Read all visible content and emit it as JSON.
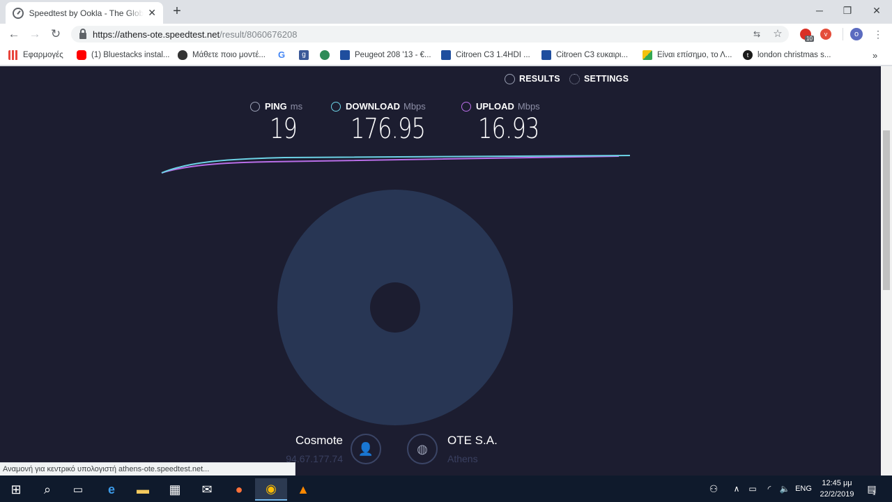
{
  "browser": {
    "tab_title": "Speedtest by Ookla - The Global Broadband Speed Test",
    "url_host": "https://athens-ote.speedtest.net",
    "url_path": "/result/8060676208",
    "ext_badge": "10",
    "profile_letter": "ο"
  },
  "bookmarks": [
    {
      "label": "Εφαρμογές",
      "color": "#e8453c"
    },
    {
      "label": "(1) Bluestacks instal...",
      "color": "#ff0000"
    },
    {
      "label": "Μάθετε ποιο μοντέ...",
      "color": "#333333"
    },
    {
      "label": "",
      "color": "#4285f4"
    },
    {
      "label": "",
      "color": "#3b5998"
    },
    {
      "label": "",
      "color": "#2e8b57"
    },
    {
      "label": "Peugeot 208 '13 - €...",
      "color": "#1f4e9e"
    },
    {
      "label": "Citroen C3 1.4HDI ...",
      "color": "#1f4e9e"
    },
    {
      "label": "Citroen C3 ευκαιρι...",
      "color": "#1f4e9e"
    },
    {
      "label": "Είναι επίσημο, το Λ...",
      "color": "#f4c20d"
    },
    {
      "label": "london christmas s...",
      "color": "#1a1a1a"
    }
  ],
  "header": {
    "results": "RESULTS",
    "settings": "SETTINGS"
  },
  "metrics": {
    "ping": {
      "label": "PING",
      "unit": "ms",
      "value": "19",
      "color": "#9aa0b4"
    },
    "download": {
      "label": "DOWNLOAD",
      "unit": "Mbps",
      "value": "176.95",
      "color": "#6dd3e6"
    },
    "upload": {
      "label": "UPLOAD",
      "unit": "Mbps",
      "value": "16.93",
      "color": "#b96ee8"
    }
  },
  "isp": {
    "provider": "Cosmote",
    "ip": "94.67.177.74",
    "server": "OTE S.A.",
    "city": "Athens"
  },
  "status_text": "Αναμονή για κεντρικό υπολογιστή athens-ote.speedtest.net...",
  "taskbar": {
    "lang": "ENG",
    "time": "12:45 μμ",
    "date": "22/2/2019",
    "notif_count": "1"
  }
}
